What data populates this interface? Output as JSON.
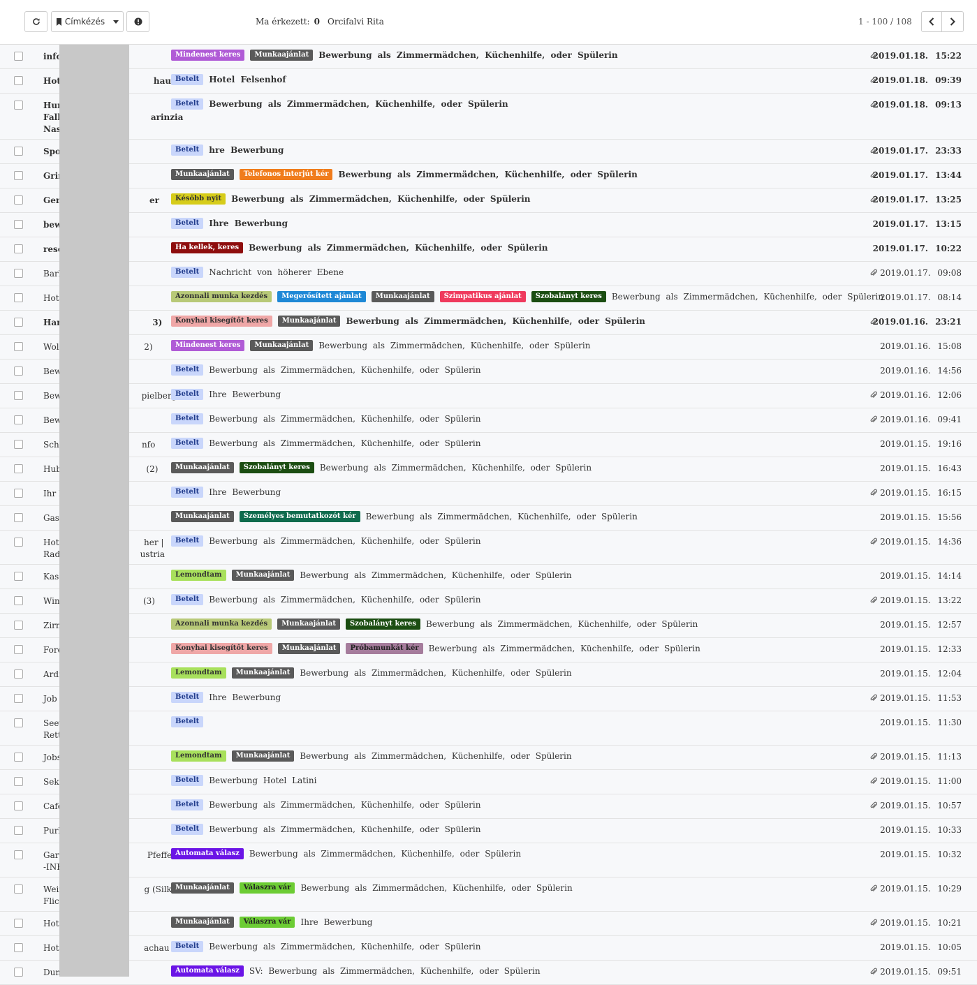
{
  "toolbar": {
    "label_button": "Címkézés",
    "today_label": "Ma érkezett:",
    "today_count": "0",
    "user_name": "Orcifalvi Rita",
    "pager": "1 - 100 / 108"
  },
  "tag_colors": {
    "Betelt": [
      "#c9d6fb",
      "#1f3a8a"
    ],
    "Mindenest keres": [
      "#b05bd6",
      "#fff"
    ],
    "Munkaajánlat": [
      "#5a5a5a",
      "#fff"
    ],
    "Telefonos interjút kér": [
      "#f07c1c",
      "#fff"
    ],
    "Később nyit": [
      "#d6cc1a",
      "#333"
    ],
    "Ha kellek, keres": [
      "#8e0d0d",
      "#fff"
    ],
    "Azonnali munka kezdés": [
      "#b8c978",
      "#333"
    ],
    "Megerősített ajánlat": [
      "#1e88d6",
      "#fff"
    ],
    "Szimpatikus ajánlat": [
      "#ef3a5d",
      "#fff"
    ],
    "Szobalányt keres": [
      "#1b4d12",
      "#fff"
    ],
    "Konyhai kisegítőt keres": [
      "#efa7a7",
      "#333"
    ],
    "Személyes bemutatkozót kér": [
      "#0e6b4d",
      "#fff"
    ],
    "Lemondtam": [
      "#a8e05c",
      "#333"
    ],
    "Próbamunkát kér": [
      "#a57c9c",
      "#222"
    ],
    "Automata válasz": [
      "#6a14e6",
      "#fff"
    ],
    "Válaszra vár": [
      "#6ccc34",
      "#222"
    ]
  },
  "rows": [
    {
      "sender": "info",
      "tags": [
        "Mindenest keres",
        "Munkaajánlat"
      ],
      "subject": "Bewerbung als Zimmermädchen, Küchenhilfe, oder Spülerin",
      "date": "2019.01.18. 15:22",
      "attach": true,
      "bold": true,
      "h": 1
    },
    {
      "sender": "Hote                              hau",
      "tags": [
        "Betelt"
      ],
      "subject": "Hotel Felsenhof",
      "date": "2019.01.18. 09:39",
      "attach": true,
      "bold": true,
      "h": 1
    },
    {
      "sender": "Hum\nFalk                              arinzia\nNass",
      "tags": [
        "Betelt"
      ],
      "subject": "Bewerbung als Zimmermädchen, Küchenhilfe, oder Spülerin",
      "date": "2019.01.18. 09:13",
      "attach": true,
      "bold": true,
      "h": 3
    },
    {
      "sender": "Spor",
      "tags": [
        "Betelt"
      ],
      "subject": "hre Bewerbung",
      "date": "2019.01.17. 23:33",
      "attach": true,
      "bold": true,
      "h": 1
    },
    {
      "sender": "Grin",
      "tags": [
        "Munkaajánlat",
        "Telefonos interjút kér"
      ],
      "subject": "Bewerbung als Zimmermädchen, Küchenhilfe, oder Spülerin",
      "date": "2019.01.17. 13:44",
      "attach": true,
      "bold": true,
      "h": 1
    },
    {
      "sender": "Gen                              er",
      "tags": [
        "Később nyit"
      ],
      "subject": "Bewerbung als Zimmermädchen, Küchenhilfe, oder Spülerin",
      "date": "2019.01.17. 13:25",
      "attach": true,
      "bold": true,
      "h": 1
    },
    {
      "sender": "bewe",
      "tags": [
        "Betelt"
      ],
      "subject": "Ihre Bewerbung",
      "date": "2019.01.17. 13:15",
      "attach": false,
      "bold": true,
      "h": 1
    },
    {
      "sender": "reser",
      "tags": [
        "Ha kellek, keres"
      ],
      "subject": "Bewerbung als Zimmermädchen, Küchenhilfe, oder Spülerin",
      "date": "2019.01.17. 10:22",
      "attach": false,
      "bold": true,
      "h": 1
    },
    {
      "sender": "Barb",
      "tags": [
        "Betelt"
      ],
      "subject": "Nachricht von höherer Ebene",
      "date": "2019.01.17. 09:08",
      "attach": true,
      "bold": false,
      "h": 1
    },
    {
      "sender": "Hote",
      "tags": [
        "Azonnali munka kezdés",
        "Megerősített ajánlat",
        "Munkaajánlat",
        "Szimpatikus ajánlat",
        "Szobalányt keres"
      ],
      "subject": "Bewerbung als Zimmermädchen, Küchenhilfe, oder Spülerin",
      "date": "2019.01.17. 08:14",
      "attach": false,
      "bold": false,
      "h": 1
    },
    {
      "sender": "Hart                              3)",
      "tags": [
        "Konyhai kisegítőt keres",
        "Munkaajánlat"
      ],
      "subject": "Bewerbung als Zimmermädchen, Küchenhilfe, oder Spülerin",
      "date": "2019.01.16. 23:21",
      "attach": true,
      "bold": true,
      "h": 1
    },
    {
      "sender": "Wolk                              2)",
      "tags": [
        "Mindenest keres",
        "Munkaajánlat"
      ],
      "subject": "Bewerbung als Zimmermädchen, Küchenhilfe, oder Spülerin",
      "date": "2019.01.16. 15:08",
      "attach": false,
      "bold": false,
      "h": 1
    },
    {
      "sender": "Bew",
      "tags": [
        "Betelt"
      ],
      "subject": "Bewerbung als Zimmermädchen, Küchenhilfe, oder Spülerin",
      "date": "2019.01.16. 14:56",
      "attach": false,
      "bold": false,
      "h": 1
    },
    {
      "sender": "Bew                              pielberg",
      "tags": [
        "Betelt"
      ],
      "subject": "Ihre Bewerbung",
      "date": "2019.01.16. 12:06",
      "attach": true,
      "bold": false,
      "h": 1
    },
    {
      "sender": "Bew",
      "tags": [
        "Betelt"
      ],
      "subject": "Bewerbung als Zimmermädchen, Küchenhilfe, oder Spülerin",
      "date": "2019.01.16. 09:41",
      "attach": true,
      "bold": false,
      "h": 1
    },
    {
      "sender": "Schl                              nfo",
      "tags": [
        "Betelt"
      ],
      "subject": "Bewerbung als Zimmermädchen, Küchenhilfe, oder Spülerin",
      "date": "2019.01.15. 19:16",
      "attach": false,
      "bold": false,
      "h": 1
    },
    {
      "sender": "Hube                              (2)",
      "tags": [
        "Munkaajánlat",
        "Szobalányt keres"
      ],
      "subject": "Bewerbung als Zimmermädchen, Küchenhilfe, oder Spülerin",
      "date": "2019.01.15. 16:43",
      "attach": false,
      "bold": false,
      "h": 1
    },
    {
      "sender": "Ihr K",
      "tags": [
        "Betelt"
      ],
      "subject": "Ihre Bewerbung",
      "date": "2019.01.15. 16:15",
      "attach": true,
      "bold": false,
      "h": 1
    },
    {
      "sender": "Gast",
      "tags": [
        "Munkaajánlat",
        "Személyes bemutatkozót kér"
      ],
      "subject": "Bewerbung als Zimmermädchen, Küchenhilfe, oder Spülerin",
      "date": "2019.01.15. 15:56",
      "attach": false,
      "bold": false,
      "h": 1
    },
    {
      "sender": "Hote                              her |\nRad                              ustria",
      "tags": [
        "Betelt"
      ],
      "subject": "Bewerbung als Zimmermädchen, Küchenhilfe, oder Spülerin",
      "date": "2019.01.15. 14:36",
      "attach": true,
      "bold": false,
      "h": 2
    },
    {
      "sender": "Kase",
      "tags": [
        "Lemondtam",
        "Munkaajánlat"
      ],
      "subject": "Bewerbung als Zimmermädchen, Küchenhilfe, oder Spülerin",
      "date": "2019.01.15. 14:14",
      "attach": false,
      "bold": false,
      "h": 1
    },
    {
      "sender": "Wint                              (3)",
      "tags": [
        "Betelt"
      ],
      "subject": "Bewerbung als Zimmermädchen, Küchenhilfe, oder Spülerin",
      "date": "2019.01.15. 13:22",
      "attach": true,
      "bold": false,
      "h": 1
    },
    {
      "sender": "Zirm",
      "tags": [
        "Azonnali munka kezdés",
        "Munkaajánlat",
        "Szobalányt keres"
      ],
      "subject": "Bewerbung als Zimmermädchen, Küchenhilfe, oder Spülerin",
      "date": "2019.01.15. 12:57",
      "attach": false,
      "bold": false,
      "h": 1
    },
    {
      "sender": "Fore",
      "tags": [
        "Konyhai kisegítőt keres",
        "Munkaajánlat",
        "Próbamunkát kér"
      ],
      "subject": "Bewerbung als Zimmermädchen, Küchenhilfe, oder Spülerin",
      "date": "2019.01.15. 12:33",
      "attach": false,
      "bold": false,
      "h": 1
    },
    {
      "sender": "Ardr",
      "tags": [
        "Lemondtam",
        "Munkaajánlat"
      ],
      "subject": "Bewerbung als Zimmermädchen, Küchenhilfe, oder Spülerin",
      "date": "2019.01.15. 12:04",
      "attach": false,
      "bold": false,
      "h": 1
    },
    {
      "sender": "Job",
      "tags": [
        "Betelt"
      ],
      "subject": "Ihre Bewerbung",
      "date": "2019.01.15. 11:53",
      "attach": true,
      "bold": false,
      "h": 1
    },
    {
      "sender": "Seev\nRette",
      "tags": [
        "Betelt"
      ],
      "subject": "",
      "date": "2019.01.15. 11:30",
      "attach": false,
      "bold": false,
      "h": 2
    },
    {
      "sender": "Jobs",
      "tags": [
        "Lemondtam",
        "Munkaajánlat"
      ],
      "subject": "Bewerbung als Zimmermädchen, Küchenhilfe, oder Spülerin",
      "date": "2019.01.15. 11:13",
      "attach": true,
      "bold": false,
      "h": 1
    },
    {
      "sender": "Sekr",
      "tags": [
        "Betelt"
      ],
      "subject": "Bewerbung Hotel Latini",
      "date": "2019.01.15. 11:00",
      "attach": true,
      "bold": false,
      "h": 1
    },
    {
      "sender": "Cafe",
      "tags": [
        "Betelt"
      ],
      "subject": "Bewerbung als Zimmermädchen, Küchenhilfe, oder Spülerin",
      "date": "2019.01.15. 10:57",
      "attach": true,
      "bold": false,
      "h": 1
    },
    {
      "sender": "Purk",
      "tags": [
        "Betelt"
      ],
      "subject": "Bewerbung als Zimmermädchen, Küchenhilfe, oder Spülerin",
      "date": "2019.01.15. 10:33",
      "attach": false,
      "bold": false,
      "h": 1
    },
    {
      "sender": "Garte                              Pfeffel\n-INE",
      "tags": [
        "Automata válasz"
      ],
      "subject": "Bewerbung als Zimmermädchen, Küchenhilfe, oder Spülerin",
      "date": "2019.01.15. 10:32",
      "attach": false,
      "bold": false,
      "h": 2
    },
    {
      "sender": "Wein                              g (Silke\nFlick",
      "tags": [
        "Munkaajánlat",
        "Válaszra vár"
      ],
      "subject": "Bewerbung als Zimmermädchen, Küchenhilfe, oder Spülerin",
      "date": "2019.01.15. 10:29",
      "attach": true,
      "bold": false,
      "h": 2
    },
    {
      "sender": "Hote",
      "tags": [
        "Munkaajánlat",
        "Válaszra vár"
      ],
      "subject": "Ihre Bewerbung",
      "date": "2019.01.15. 10:21",
      "attach": true,
      "bold": false,
      "h": 1
    },
    {
      "sender": "Hote                              achau",
      "tags": [
        "Betelt"
      ],
      "subject": "Bewerbung als Zimmermädchen, Küchenhilfe, oder Spülerin",
      "date": "2019.01.15. 10:05",
      "attach": false,
      "bold": false,
      "h": 1
    },
    {
      "sender": "Duni",
      "tags": [
        "Automata válasz"
      ],
      "subject": "SV: Bewerbung als Zimmermädchen, Küchenhilfe, oder Spülerin",
      "date": "2019.01.15. 09:51",
      "attach": true,
      "bold": false,
      "h": 1
    }
  ]
}
